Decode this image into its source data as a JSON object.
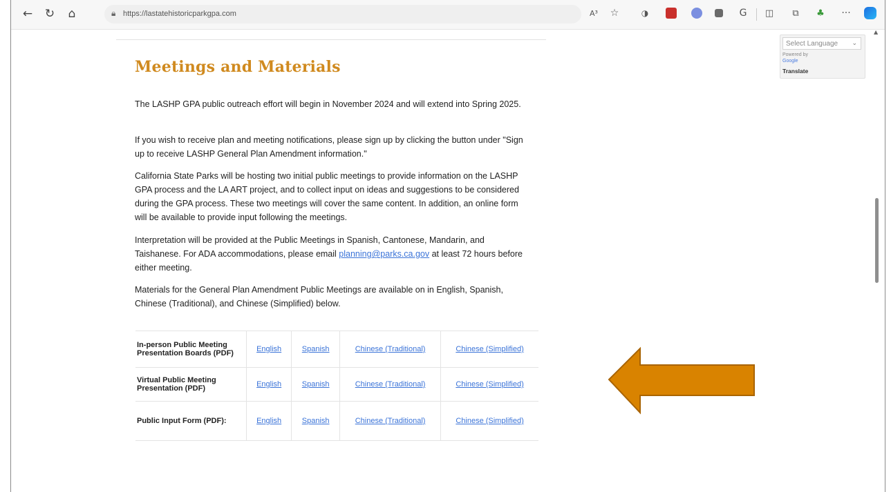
{
  "browser": {
    "url": "https://lastatehistoricparkgpa.com",
    "icons": [
      "back-icon",
      "refresh-icon",
      "home-icon",
      "site-info-icon",
      "read-aloud-icon",
      "favorite-star-icon",
      "extension-icon",
      "split-screen-icon",
      "collections-icon",
      "more-icon",
      "copilot-icon"
    ],
    "read_aloud_label": "A³",
    "more_label": "···"
  },
  "translate": {
    "select_label": "Select Language",
    "powered_by": "Powered by",
    "google": "Google",
    "translate_link": "Translate"
  },
  "main": {
    "heading": "Meetings and Materials",
    "para1": "The LASHP GPA public outreach effort will begin in November 2024 and will extend into Spring 2025.",
    "para2": "If you wish to receive plan and meeting notifications, please sign up by clicking the button under \"Sign up to receive LASHP General Plan Amendment information.\"",
    "para3": "California State Parks will be hosting two initial public meetings to provide information on the LASHP GPA process and the LA ART project, and to collect input on ideas and suggestions to be considered during the GPA process. These two meetings will cover the same content. In addition, an online form will be available to provide input following the meetings.",
    "para4_before": "Interpretation will be provided at the Public Meetings in Spanish, Cantonese, Mandarin, and Taishanese. For ADA accommodations, please email ",
    "para4_email": "planning@parks.ca.gov",
    "para4_after": " at least 72 hours before either meeting.",
    "para5": "Materials for the General Plan Amendment Public Meetings are available on in English, Spanish, Chinese (Traditional), and Chinese (Simplified) below."
  },
  "materials": {
    "rows": [
      {
        "label": "In-person Public Meeting Presentation Boards (PDF)",
        "links": [
          "English",
          "Spanish",
          "Chinese (Traditional)",
          "Chinese (Simplified)"
        ]
      },
      {
        "label": "Virtual Public Meeting Presentation (PDF)",
        "links": [
          "English",
          "Spanish",
          "Chinese (Traditional)",
          "Chinese (Simplified)"
        ]
      },
      {
        "label": "Public Input Form (PDF):",
        "links": [
          "English",
          "Spanish",
          "Chinese (Traditional)",
          "Chinese (Simplified)"
        ]
      }
    ]
  },
  "colors": {
    "heading": "#d08a1f",
    "link": "#3a73d8",
    "arrow_fill": "#d98300",
    "arrow_stroke": "#a86300"
  }
}
